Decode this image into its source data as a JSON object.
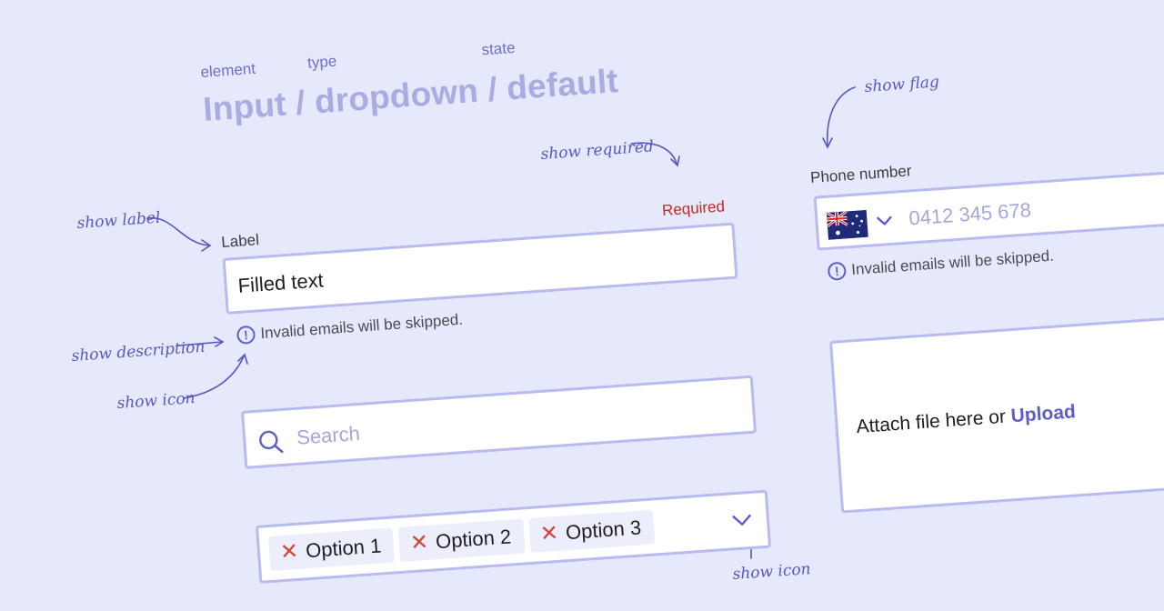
{
  "header": {
    "element_caption": "element",
    "type_caption": "type",
    "state_caption": "state",
    "title": "Input / dropdown / default"
  },
  "annotations": {
    "show_label": "show label",
    "show_description": "show description",
    "show_icon_left": "show icon",
    "show_required": "show required",
    "show_flag": "show flag",
    "show_icon_bottom": "show icon"
  },
  "text_input": {
    "label": "Label",
    "required": "Required",
    "value": "Filled text",
    "description": "Invalid emails will be skipped."
  },
  "search_input": {
    "placeholder": "Search",
    "icon": "search-icon"
  },
  "multi_select": {
    "options": [
      "Option 1",
      "Option 2",
      "Option 3"
    ],
    "remove_icon": "close-icon",
    "dropdown_icon": "chevron-down-icon"
  },
  "phone_input": {
    "label": "Phone number",
    "placeholder": "0412 345 678",
    "flag_icon": "australia-flag-icon",
    "description": "Invalid emails will be skipped."
  },
  "file_input": {
    "prefix": "Attach file here or",
    "upload_label": "Upload"
  },
  "colors": {
    "background": "#e6e9fb",
    "border": "#b7bbf0",
    "accent": "#5c5fc7",
    "required": "#c8261f",
    "title": "#a8ace2"
  }
}
